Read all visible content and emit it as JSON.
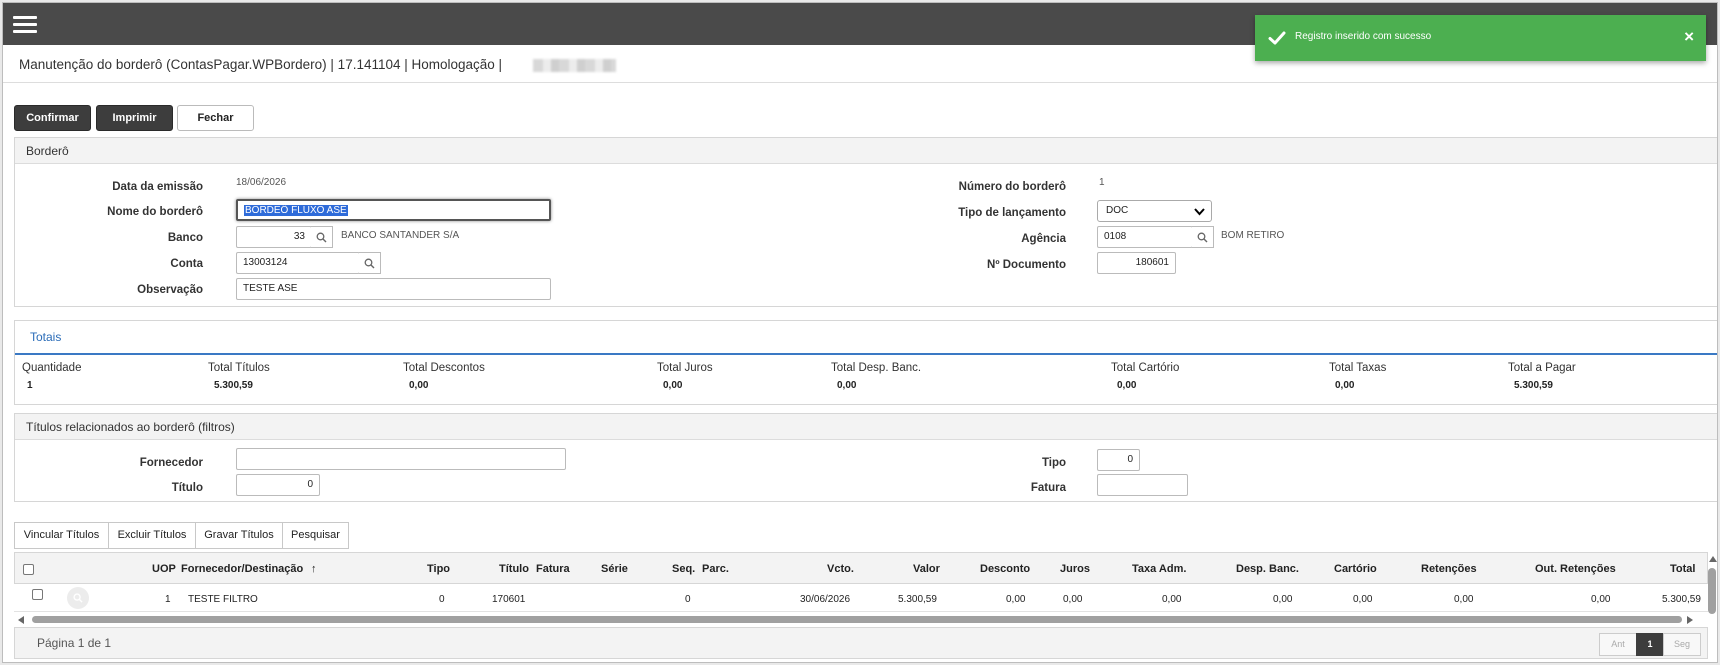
{
  "toast": {
    "message": "Registro inserido com sucesso",
    "close": "×"
  },
  "header": {
    "title": "Manutenção do borderô (ContasPagar.WPBordero) | 17.141104 | Homologação | "
  },
  "toolbar": {
    "confirm": "Confirmar",
    "print": "Imprimir",
    "close": "Fechar"
  },
  "bordero": {
    "section_title": "Borderô",
    "emission_label": "Data da emissão",
    "emission_value": "18/06/2026",
    "name_label": "Nome do borderô",
    "name_value": "BORDEÔ FLUXO ASE",
    "bank_label": "Banco",
    "bank_value": "33",
    "bank_name": "BANCO SANTANDER S/A",
    "account_label": "Conta",
    "account_value": "13003124",
    "notes_label": "Observação",
    "notes_value": "TESTE ASE",
    "number_label": "Número do borderô",
    "number_value": "1",
    "launch_type_label": "Tipo de lançamento",
    "launch_type_value": "DOC",
    "agency_label": "Agência",
    "agency_value": "0108",
    "agency_name": "BOM RETIRO",
    "document_label": "Nº Documento",
    "document_value": "180601"
  },
  "totals": {
    "tab_label": "Totais",
    "items": [
      {
        "label": "Quantidade",
        "value": "1"
      },
      {
        "label": "Total Títulos",
        "value": "5.300,59"
      },
      {
        "label": "Total Descontos",
        "value": "0,00"
      },
      {
        "label": "Total Juros",
        "value": "0,00"
      },
      {
        "label": "Total Desp. Banc.",
        "value": "0,00"
      },
      {
        "label": "Total Cartório",
        "value": "0,00"
      },
      {
        "label": "Total Taxas",
        "value": "0,00"
      },
      {
        "label": "Total a Pagar",
        "value": "5.300,59"
      }
    ]
  },
  "filters": {
    "section_title": "Títulos relacionados ao borderô (filtros)",
    "supplier_label": "Fornecedor",
    "supplier_value": "",
    "title_label": "Título",
    "title_value": "0",
    "type_label": "Tipo",
    "type_value": "0",
    "invoice_label": "Fatura",
    "invoice_value": ""
  },
  "actions": {
    "link": "Vincular Títulos",
    "delete": "Excluir Títulos",
    "save": "Gravar Títulos",
    "search": "Pesquisar"
  },
  "table": {
    "columns": [
      "UOP",
      "Fornecedor/Destinação",
      "Tipo",
      "Título",
      "Fatura",
      "Série",
      "Seq.",
      "Parc.",
      "Vcto.",
      "Valor",
      "Desconto",
      "Juros",
      "Taxa Adm.",
      "Desp. Banc.",
      "Cartório",
      "Retenções",
      "Out. Retenções",
      "Total"
    ],
    "sort_arrow": "↑",
    "rows": [
      {
        "uop": "1",
        "supplier": "TESTE FILTRO",
        "type": "0",
        "title": "170601",
        "invoice": "",
        "series": "",
        "seq": "0",
        "parc": "",
        "due": "30/06/2026",
        "value": "5.300,59",
        "discount": "0,00",
        "interest": "0,00",
        "admin_fee": "0,00",
        "bank_exp": "0,00",
        "registry": "0,00",
        "withholdings": "0,00",
        "other_withholdings": "0,00",
        "total": "5.300,59"
      }
    ]
  },
  "pager": {
    "info": "Página 1 de 1",
    "prev": "Ant",
    "page": "1",
    "next": "Seg"
  }
}
